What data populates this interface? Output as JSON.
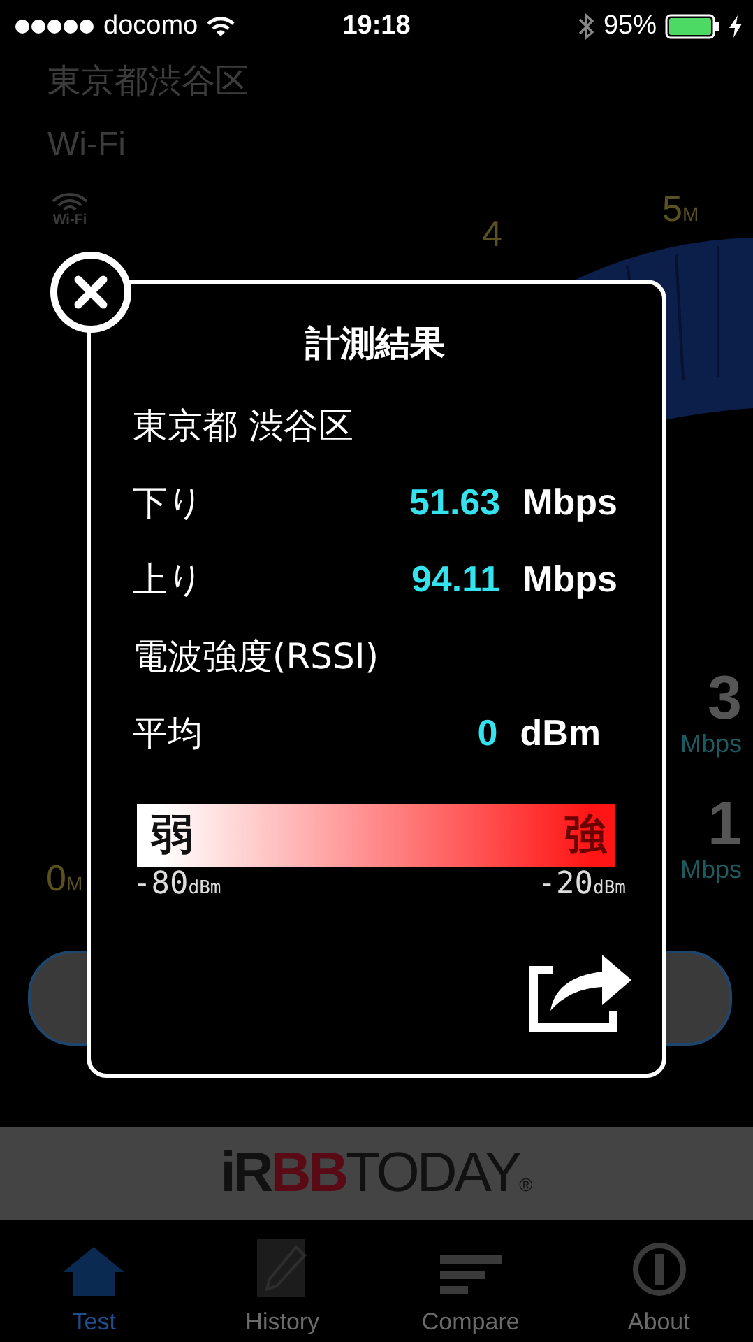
{
  "status_bar": {
    "carrier": "docomo",
    "time": "19:18",
    "battery": "95%",
    "charging": true
  },
  "background": {
    "location": "東京都渋谷区",
    "network": "Wi-Fi",
    "network_icon_label": "Wi-Fi",
    "gauge_labels": [
      {
        "value": "4"
      },
      {
        "value": "5",
        "unit": "M"
      },
      {
        "value": "0",
        "unit": "M"
      }
    ],
    "readings": [
      {
        "value": "3",
        "unit": "Mbps"
      },
      {
        "value": "1",
        "unit": "Mbps"
      }
    ]
  },
  "dialog": {
    "title": "計測結果",
    "location": "東京都 渋谷区",
    "rows": [
      {
        "label": "下り",
        "value": "51.63",
        "unit": "Mbps"
      },
      {
        "label": "上り",
        "value": "94.11",
        "unit": "Mbps"
      }
    ],
    "rssi_heading": "電波強度(RSSI)",
    "rssi_row": {
      "label": "平均",
      "value": "0",
      "unit": "dBm"
    },
    "scale": {
      "weak": "弱",
      "strong": "強",
      "min": {
        "value": "-80",
        "unit": "dBm"
      },
      "max": {
        "value": "-20",
        "unit": "dBm"
      }
    }
  },
  "banner": {
    "logo_start": "iR",
    "logo_middle": "BB",
    "logo_end": "TODAY",
    "mark": "®"
  },
  "tabs": [
    {
      "kind": "home",
      "label": "Test",
      "selected": true
    },
    {
      "kind": "pencil",
      "label": "History",
      "selected": false
    },
    {
      "kind": "bars",
      "label": "Compare",
      "selected": false
    },
    {
      "kind": "info",
      "label": "About",
      "selected": false
    }
  ]
}
